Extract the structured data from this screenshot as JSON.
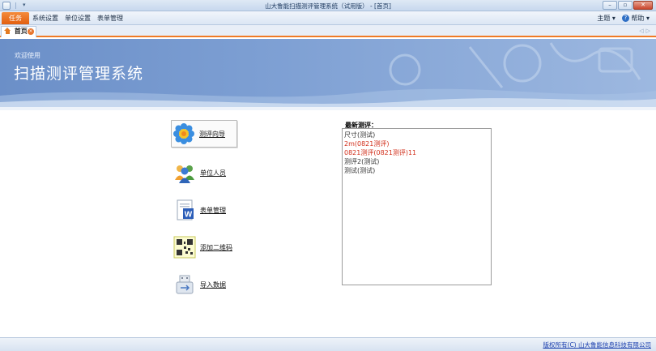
{
  "window": {
    "title": "山大鲁能扫描测评管理系统（试用版） - [首页]",
    "controls": {
      "minimize": "–",
      "maximize": "▫",
      "close": "✕"
    }
  },
  "qat": {
    "arrow": "▾"
  },
  "menu": {
    "task_tab": "任务",
    "items": [
      "系统设置",
      "单位设置",
      "表单管理"
    ],
    "theme": "主题 ▾",
    "help": "帮助 ▾",
    "help_glyph": "?"
  },
  "tabs": {
    "active": "首页",
    "close_glyph": "×",
    "nav": "◁▷"
  },
  "banner": {
    "welcome": "欢迎使用",
    "app_name": "扫描测评管理系统"
  },
  "shortcuts": [
    {
      "label": "测评向导",
      "icon": "wizard-flower-icon"
    },
    {
      "label": "单位人员",
      "icon": "people-group-icon"
    },
    {
      "label": "表单管理",
      "icon": "word-document-icon"
    },
    {
      "label": "添加二维码",
      "icon": "qr-code-icon"
    },
    {
      "label": "导入数据",
      "icon": "usb-drive-icon"
    }
  ],
  "latest": {
    "title": "最新测评：",
    "items": [
      {
        "text": "尺寸(测试)",
        "color": "#333333"
      },
      {
        "text": "2m(0821测评)",
        "color": "#d2301c"
      },
      {
        "text": "0821测评(0821测评)11",
        "color": "#d2301c"
      },
      {
        "text": "测评2(测试)",
        "color": "#333333"
      },
      {
        "text": "测试(测试)",
        "color": "#333333"
      }
    ]
  },
  "footer": {
    "copyright": "版权所有(C) 山大鲁能信息科技有限公司"
  },
  "colors": {
    "accent_orange": "#f07a25",
    "banner_blue": "#7d9fd3",
    "link_blue": "#1b3fae",
    "latest_red": "#d2301c"
  }
}
